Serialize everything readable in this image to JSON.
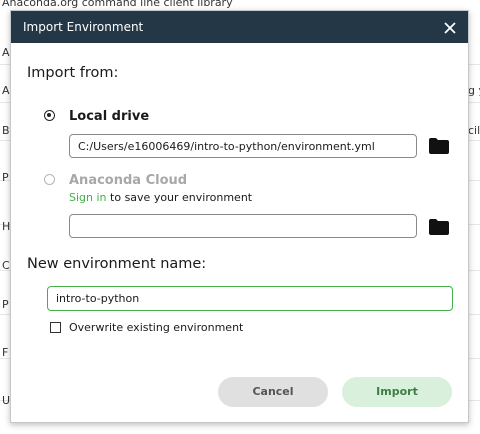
{
  "background": {
    "top_text": "Anaconda.org command line client library",
    "row_initials": [
      "A",
      "A(",
      "B",
      "P",
      "H",
      "C",
      "P",
      "F",
      "U"
    ],
    "right_fragments": [
      "g y",
      "cili"
    ]
  },
  "dialog": {
    "title": "Import Environment",
    "close_glyph": "✕",
    "import_from_label": "Import from:",
    "local_drive": {
      "label": "Local drive",
      "selected": true,
      "path_value": "C:/Users/e16006469/intro-to-python/environment.yml"
    },
    "anaconda_cloud": {
      "label": "Anaconda Cloud",
      "selected": false,
      "signin_link": "Sign in",
      "signin_suffix": " to save your environment",
      "value": ""
    },
    "new_env_label": "New environment name:",
    "env_name_value": "intro-to-python",
    "overwrite_label": "Overwrite existing environment",
    "overwrite_checked": false,
    "cancel_label": "Cancel",
    "import_label": "Import"
  },
  "icons": {
    "folder": "folder-icon",
    "close": "close-icon"
  },
  "colors": {
    "titlebar": "#243746",
    "accent_green": "#43b049",
    "import_btn_bg": "#d9f0dc",
    "cancel_btn_bg": "#e0e0e0"
  }
}
